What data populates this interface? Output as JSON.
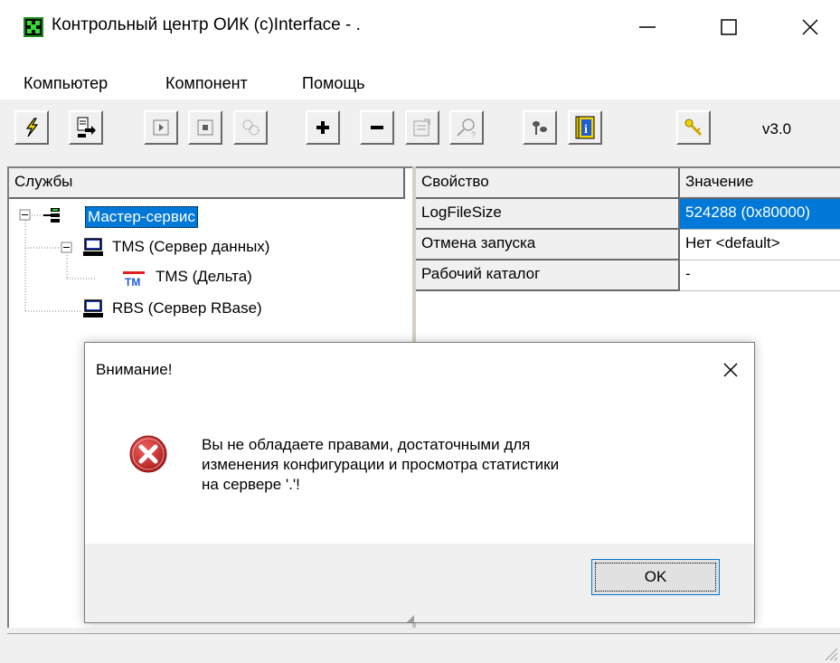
{
  "window": {
    "title": "Контрольный центр ОИК (c)Interface - .",
    "minimize_glyph": "—",
    "maximize_glyph": "☐",
    "close_glyph": "✕"
  },
  "menu": {
    "items": [
      {
        "label": "Компьютер"
      },
      {
        "label": "Компонент"
      },
      {
        "label": "Помощь"
      }
    ]
  },
  "toolbar": {
    "buttons": [
      {
        "icon": "connect-lightning-icon"
      },
      {
        "icon": "export-icon"
      },
      {
        "icon": "start-icon"
      },
      {
        "icon": "stop-icon"
      },
      {
        "icon": "pause-icon"
      },
      {
        "icon": "add-icon",
        "glyph": "+"
      },
      {
        "icon": "remove-icon",
        "glyph": "−"
      },
      {
        "icon": "properties-icon"
      },
      {
        "icon": "find-icon"
      },
      {
        "icon": "users-icon"
      },
      {
        "icon": "info-icon",
        "glyph": "i"
      },
      {
        "icon": "key-icon"
      }
    ],
    "version": "v3.0"
  },
  "tree": {
    "header": "Службы",
    "items": [
      {
        "label": "Мастер-сервис",
        "selected": true
      },
      {
        "label": "TMS (Сервер данных)"
      },
      {
        "label": "TMS (Дельта)",
        "badge": "TM"
      },
      {
        "label": "RBS (Сервер RBase)"
      }
    ]
  },
  "properties": {
    "columns": [
      "Свойство",
      "Значение"
    ],
    "rows": [
      {
        "key": "LogFileSize",
        "value": "524288 (0x80000)",
        "selected": true
      },
      {
        "key": "Отмена запуска",
        "value": "Нет <default>"
      },
      {
        "key": "Рабочий каталог",
        "value": "-"
      }
    ]
  },
  "dialog": {
    "title": "Внимание!",
    "message": "Вы не обладаете правами, достаточными для\nизменения конфигурации и просмотра статистики\nна сервере '.'!",
    "ok_label": "OK",
    "icon": "error-icon"
  },
  "colors": {
    "selection": "#0078d7",
    "error": "#c62828"
  }
}
